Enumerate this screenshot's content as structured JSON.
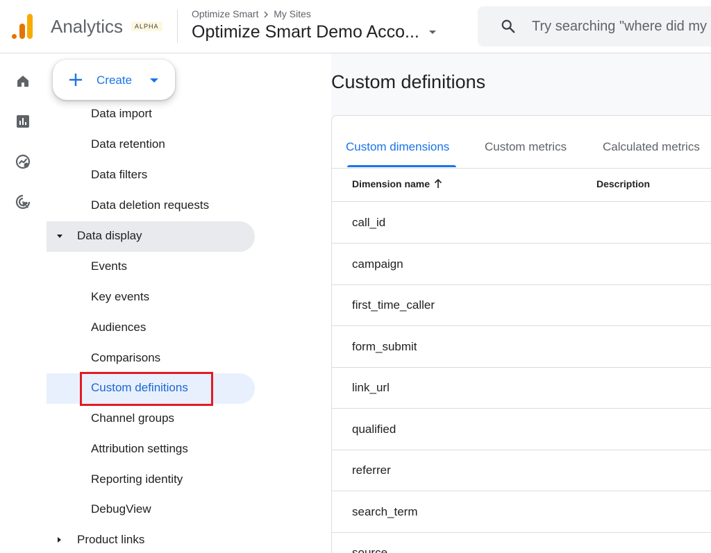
{
  "header": {
    "app_name": "Analytics",
    "badge": "ALPHA",
    "breadcrumb_parent": "Optimize Smart",
    "breadcrumb_child": "My Sites",
    "account_name": "Optimize Smart Demo Acco...",
    "search_placeholder": "Try searching \"where did my"
  },
  "rail": [
    "home-icon",
    "reports-icon",
    "explore-icon",
    "advertising-icon"
  ],
  "nav": {
    "create_label": "Create",
    "items": [
      {
        "label": "Data import"
      },
      {
        "label": "Data retention"
      },
      {
        "label": "Data filters"
      },
      {
        "label": "Data deletion requests"
      },
      {
        "label": "Data display"
      },
      {
        "label": "Events"
      },
      {
        "label": "Key events"
      },
      {
        "label": "Audiences"
      },
      {
        "label": "Comparisons"
      },
      {
        "label": "Custom definitions"
      },
      {
        "label": "Channel groups"
      },
      {
        "label": "Attribution settings"
      },
      {
        "label": "Reporting identity"
      },
      {
        "label": "DebugView"
      },
      {
        "label": "Product links"
      }
    ]
  },
  "main": {
    "title": "Custom definitions",
    "tabs": [
      {
        "label": "Custom dimensions"
      },
      {
        "label": "Custom metrics"
      },
      {
        "label": "Calculated metrics"
      }
    ],
    "columns": [
      "Dimension name",
      "Description"
    ],
    "rows": [
      "call_id",
      "campaign",
      "first_time_caller",
      "form_submit",
      "link_url",
      "qualified",
      "referrer",
      "search_term",
      "source"
    ]
  },
  "colors": {
    "accent": "#1a73e8",
    "highlight_border": "#e31b23",
    "logo_orange": "#e37400",
    "logo_yellow": "#f9ab00"
  }
}
